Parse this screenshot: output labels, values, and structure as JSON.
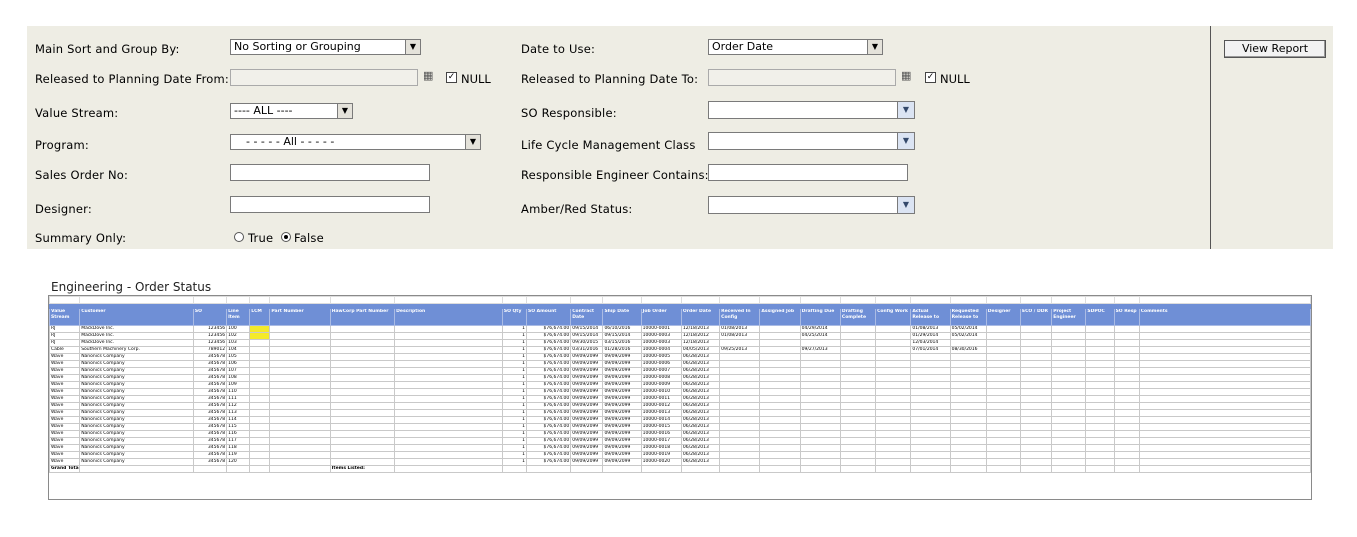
{
  "filters": {
    "main_sort_label": "Main Sort and Group By:",
    "main_sort_value": "No Sorting or Grouping",
    "date_to_use_label": "Date to Use:",
    "date_to_use_value": "Order Date",
    "rtp_from_label": "Released to Planning Date From:",
    "rtp_to_label": "Released to Planning Date To:",
    "null_label": "NULL",
    "value_stream_label": "Value Stream:",
    "value_stream_value": "---- ALL ----",
    "so_responsible_label": "SO Responsible:",
    "program_label": "Program:",
    "program_value": "- - - - - All - - - - -",
    "lcm_class_label": "Life Cycle Management Class",
    "sales_order_label": "Sales Order No:",
    "resp_engineer_label": "Responsible Engineer Contains:",
    "designer_label": "Designer:",
    "amber_red_label": "Amber/Red Status:",
    "summary_only_label": "Summary Only:",
    "true_label": "True",
    "false_label": "False",
    "summary_only_selected": "False",
    "check_mark": "✓",
    "arrow_glyph": "▼",
    "calendar_glyph": "▦"
  },
  "view_report_label": "View Report",
  "report": {
    "title": "Engineering - Order Status",
    "columns": [
      "Value Stream",
      "Customer",
      "SO",
      "Line Item",
      "LCM",
      "Part Number",
      "HawCorp Part Number",
      "Description",
      "SO Qty",
      "SO Amount",
      "Contract Date",
      "Ship Date",
      "Job Order",
      "Order Date",
      "Received In Config",
      "Assigned Job",
      "Drafting Due",
      "Drafting Complete",
      "Config Work",
      "Actual Release to",
      "Requested Release to",
      "Designer",
      "ECO / DDR",
      "Project Engineer",
      "SDPOC",
      "SO Resp",
      "Comments"
    ],
    "rows": [
      [
        "RJ",
        "MackDove Inc.",
        "123456",
        "100",
        "",
        "",
        "",
        "",
        "1",
        "$76,674.00",
        "09/15/2014",
        "06/10/2016",
        "10000-0001",
        "12/18/2013",
        "01/08/2013",
        "",
        "04/29/2014",
        "",
        "",
        "01/08/2013",
        "05/02/2014",
        "",
        "",
        "",
        "",
        "",
        ""
      ],
      [
        "RJ",
        "MackDove Inc.",
        "123456",
        "102",
        "",
        "",
        "",
        "",
        "1",
        "$76,674.00",
        "09/15/2014",
        "09/15/2014",
        "10000-0003",
        "12/18/2012",
        "01/08/2013",
        "",
        "04/25/2014",
        "",
        "",
        "01/29/2014",
        "05/02/2014",
        "",
        "",
        "",
        "",
        "",
        ""
      ],
      [
        "RJ",
        "MackDove Inc.",
        "123456",
        "103",
        "",
        "",
        "",
        "",
        "1",
        "$76,674.00",
        "09/30/2015",
        "03/15/2016",
        "10000-0003",
        "12/18/2013",
        "",
        "",
        "",
        "",
        "",
        "12/03/2014",
        "",
        "",
        "",
        "",
        "",
        "",
        ""
      ],
      [
        "Cable",
        "Southern Machinery Corp.",
        "789012",
        "104",
        "",
        "",
        "",
        "",
        "1",
        "$76,674.00",
        "03/31/2016",
        "01/28/2016",
        "10000-0004",
        "04/05/2013",
        "09/25/2013",
        "",
        "09/27/2013",
        "",
        "",
        "07/01/2014",
        "08/30/2016",
        "",
        "",
        "",
        "",
        "",
        ""
      ],
      [
        "Wave",
        "Nanonics Company",
        "345678",
        "105",
        "",
        "",
        "",
        "",
        "1",
        "$76,674.00",
        "09/09/2099",
        "09/09/2099",
        "10000-0005",
        "06/28/2013",
        "",
        "",
        "",
        "",
        "",
        "",
        "",
        "",
        "",
        "",
        "",
        "",
        ""
      ],
      [
        "Wave",
        "Nanonics Company",
        "345678",
        "106",
        "",
        "",
        "",
        "",
        "1",
        "$76,674.00",
        "09/09/2099",
        "09/09/2099",
        "10000-0006",
        "06/28/2013",
        "",
        "",
        "",
        "",
        "",
        "",
        "",
        "",
        "",
        "",
        "",
        "",
        ""
      ],
      [
        "Wave",
        "Nanonics Company",
        "345678",
        "107",
        "",
        "",
        "",
        "",
        "1",
        "$76,674.00",
        "09/09/2099",
        "09/09/2099",
        "10000-0007",
        "06/28/2013",
        "",
        "",
        "",
        "",
        "",
        "",
        "",
        "",
        "",
        "",
        "",
        "",
        ""
      ],
      [
        "Wave",
        "Nanonics Company",
        "345678",
        "108",
        "",
        "",
        "",
        "",
        "1",
        "$76,674.00",
        "09/09/2099",
        "09/09/2099",
        "10000-0008",
        "06/28/2013",
        "",
        "",
        "",
        "",
        "",
        "",
        "",
        "",
        "",
        "",
        "",
        "",
        ""
      ],
      [
        "Wave",
        "Nanonics Company",
        "345678",
        "109",
        "",
        "",
        "",
        "",
        "1",
        "$76,674.00",
        "09/09/2099",
        "09/09/2099",
        "10000-0009",
        "06/28/2013",
        "",
        "",
        "",
        "",
        "",
        "",
        "",
        "",
        "",
        "",
        "",
        "",
        ""
      ],
      [
        "Wave",
        "Nanonics Company",
        "345678",
        "110",
        "",
        "",
        "",
        "",
        "1",
        "$76,674.00",
        "09/09/2099",
        "09/09/2099",
        "10000-0010",
        "06/28/2013",
        "",
        "",
        "",
        "",
        "",
        "",
        "",
        "",
        "",
        "",
        "",
        "",
        ""
      ],
      [
        "Wave",
        "Nanonics Company",
        "345678",
        "111",
        "",
        "",
        "",
        "",
        "1",
        "$76,674.00",
        "09/09/2099",
        "09/09/2099",
        "10000-0011",
        "06/28/2013",
        "",
        "",
        "",
        "",
        "",
        "",
        "",
        "",
        "",
        "",
        "",
        "",
        ""
      ],
      [
        "Wave",
        "Nanonics Company",
        "345678",
        "112",
        "",
        "",
        "",
        "",
        "1",
        "$76,674.00",
        "09/09/2099",
        "09/09/2099",
        "10000-0012",
        "06/28/2013",
        "",
        "",
        "",
        "",
        "",
        "",
        "",
        "",
        "",
        "",
        "",
        "",
        ""
      ],
      [
        "Wave",
        "Nanonics Company",
        "345678",
        "113",
        "",
        "",
        "",
        "",
        "1",
        "$76,674.00",
        "09/09/2099",
        "09/09/2099",
        "10000-0013",
        "06/28/2013",
        "",
        "",
        "",
        "",
        "",
        "",
        "",
        "",
        "",
        "",
        "",
        "",
        ""
      ],
      [
        "Wave",
        "Nanonics Company",
        "345678",
        "114",
        "",
        "",
        "",
        "",
        "1",
        "$76,674.00",
        "09/09/2099",
        "09/09/2099",
        "10000-0014",
        "06/28/2013",
        "",
        "",
        "",
        "",
        "",
        "",
        "",
        "",
        "",
        "",
        "",
        "",
        ""
      ],
      [
        "Wave",
        "Nanonics Company",
        "345678",
        "115",
        "",
        "",
        "",
        "",
        "1",
        "$76,674.00",
        "09/09/2099",
        "09/09/2099",
        "10000-0015",
        "06/28/2013",
        "",
        "",
        "",
        "",
        "",
        "",
        "",
        "",
        "",
        "",
        "",
        "",
        ""
      ],
      [
        "Wave",
        "Nanonics Company",
        "345678",
        "116",
        "",
        "",
        "",
        "",
        "1",
        "$76,674.00",
        "09/09/2099",
        "09/09/2099",
        "10000-0016",
        "06/28/2013",
        "",
        "",
        "",
        "",
        "",
        "",
        "",
        "",
        "",
        "",
        "",
        "",
        ""
      ],
      [
        "Wave",
        "Nanonics Company",
        "345678",
        "117",
        "",
        "",
        "",
        "",
        "1",
        "$76,674.00",
        "09/09/2099",
        "09/09/2099",
        "10000-0017",
        "06/28/2013",
        "",
        "",
        "",
        "",
        "",
        "",
        "",
        "",
        "",
        "",
        "",
        "",
        ""
      ],
      [
        "Wave",
        "Nanonics Company",
        "345678",
        "118",
        "",
        "",
        "",
        "",
        "1",
        "$76,674.00",
        "09/09/2099",
        "09/09/2099",
        "10000-0018",
        "06/28/2013",
        "",
        "",
        "",
        "",
        "",
        "",
        "",
        "",
        "",
        "",
        "",
        "",
        ""
      ],
      [
        "Wave",
        "Nanonics Company",
        "345678",
        "119",
        "",
        "",
        "",
        "",
        "1",
        "$76,674.00",
        "09/09/2099",
        "09/09/2099",
        "10000-0019",
        "06/28/2013",
        "",
        "",
        "",
        "",
        "",
        "",
        "",
        "",
        "",
        "",
        "",
        "",
        ""
      ],
      [
        "Wave",
        "Nanonics Company",
        "345678",
        "120",
        "",
        "",
        "",
        "",
        "1",
        "$76,674.00",
        "09/09/2099",
        "09/09/2099",
        "10000-0020",
        "06/28/2013",
        "",
        "",
        "",
        "",
        "",
        "",
        "",
        "",
        "",
        "",
        "",
        "",
        ""
      ]
    ],
    "highlight_color": "#f4ea2a",
    "header_color": "#6f8fd6",
    "grand_total_label": "Grand Total",
    "items_listed_label": "Items Listed:"
  }
}
